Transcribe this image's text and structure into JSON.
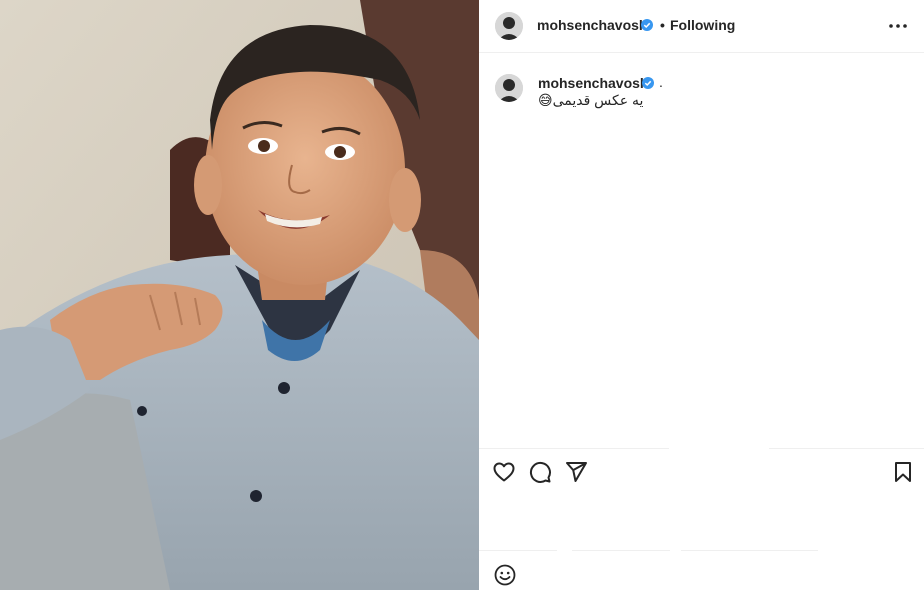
{
  "post": {
    "username": "mohsenchavoshi",
    "follow_state": "Following",
    "separator_dot": "•",
    "caption": {
      "username": "mohsenchavoshi",
      "trailing": ".",
      "text": "یه عکس قدیمی😅"
    }
  },
  "colors": {
    "verified": "#3897f0",
    "text": "#262626",
    "divider": "#efefef"
  },
  "icons": {
    "more": "more-options-icon",
    "like": "heart-icon",
    "comment": "comment-icon",
    "share": "share-icon",
    "save": "bookmark-icon",
    "emoji": "emoji-icon"
  }
}
